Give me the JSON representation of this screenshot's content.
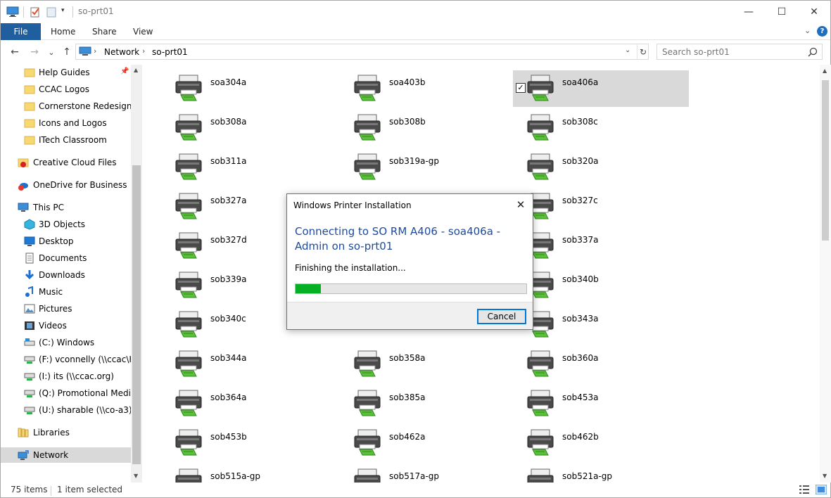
{
  "window": {
    "title": "so-prt01",
    "minimize_glyph": "—",
    "maximize_glyph": "☐",
    "close_glyph": "✕"
  },
  "ribbon": {
    "tabs": [
      "File",
      "Home",
      "Share",
      "View"
    ],
    "expand_glyph": "⌄",
    "help_glyph": "?"
  },
  "address": {
    "back_glyph": "←",
    "forward_glyph": "→",
    "recent_glyph": "⌄",
    "up_glyph": "↑",
    "crumbs": [
      "Network",
      "so-prt01"
    ],
    "crumb_sep": "›",
    "dropdown_glyph": "⌄",
    "refresh_glyph": "↻"
  },
  "search": {
    "placeholder": "Search so-prt01"
  },
  "sidebar": {
    "items": [
      {
        "label": "Help Guides",
        "icon": "folder-icon",
        "indent": 1,
        "pinned": true
      },
      {
        "label": "CCAC Logos",
        "icon": "folder-icon",
        "indent": 1
      },
      {
        "label": "Cornerstone Redesign",
        "icon": "folder-icon",
        "indent": 1
      },
      {
        "label": "Icons and Logos",
        "icon": "folder-icon",
        "indent": 1
      },
      {
        "label": "ITech Classroom",
        "icon": "folder-icon",
        "indent": 1
      },
      {
        "label": "Creative Cloud Files",
        "icon": "creative-cloud-icon",
        "indent": 0
      },
      {
        "label": "OneDrive for Business",
        "icon": "onedrive-icon",
        "indent": 0
      },
      {
        "label": "This PC",
        "icon": "computer-icon",
        "indent": 0
      },
      {
        "label": "3D Objects",
        "icon": "cube-icon",
        "indent": 1
      },
      {
        "label": "Desktop",
        "icon": "desktop-icon",
        "indent": 1
      },
      {
        "label": "Documents",
        "icon": "documents-icon",
        "indent": 1
      },
      {
        "label": "Downloads",
        "icon": "download-icon",
        "indent": 1
      },
      {
        "label": "Music",
        "icon": "music-icon",
        "indent": 1
      },
      {
        "label": "Pictures",
        "icon": "pictures-icon",
        "indent": 1
      },
      {
        "label": "Videos",
        "icon": "videos-icon",
        "indent": 1
      },
      {
        "label": "(C:) Windows",
        "icon": "drive-icon",
        "indent": 1
      },
      {
        "label": "(F:) vconnelly (\\\\ccac\\Ho",
        "icon": "network-drive-icon",
        "indent": 1
      },
      {
        "label": "(I:) its (\\\\ccac.org)",
        "icon": "network-drive-icon",
        "indent": 1
      },
      {
        "label": "(Q:) Promotional Media",
        "icon": "network-drive-icon",
        "indent": 1
      },
      {
        "label": "(U:) sharable (\\\\co-a3)",
        "icon": "network-drive-icon",
        "indent": 1
      },
      {
        "label": "Libraries",
        "icon": "libraries-icon",
        "indent": 0
      },
      {
        "label": "Network",
        "icon": "network-icon",
        "indent": 0,
        "selected": true
      }
    ]
  },
  "printers": [
    "soa304a",
    "soa403b",
    "soa406a",
    "sob308a",
    "sob308b",
    "sob308c",
    "sob311a",
    "sob319a-gp",
    "sob320a",
    "sob327a",
    "",
    "sob327c",
    "sob327d",
    "",
    "sob337a",
    "sob339a",
    "",
    "sob340b",
    "sob340c",
    "",
    "sob343a",
    "sob344a",
    "sob358a",
    "sob360a",
    "sob364a",
    "sob385a",
    "sob453a",
    "sob453b",
    "sob462a",
    "sob462b",
    "sob515a-gp",
    "sob517a-gp",
    "sob521a-gp"
  ],
  "selected_printer": "soa406a",
  "check_glyph": "✓",
  "status": {
    "item_count": "75 items",
    "selection": "1 item selected"
  },
  "dialog": {
    "title": "Windows Printer Installation",
    "close_glyph": "✕",
    "heading": "Connecting to SO RM A406 - soa406a - Admin on so-prt01",
    "status": "Finishing the installation...",
    "progress": 0.11,
    "cancel_label": "Cancel"
  },
  "colors": {
    "accent": "#1f5fa0",
    "dialog_heading": "#1e4a9c",
    "progress": "#06b025"
  }
}
